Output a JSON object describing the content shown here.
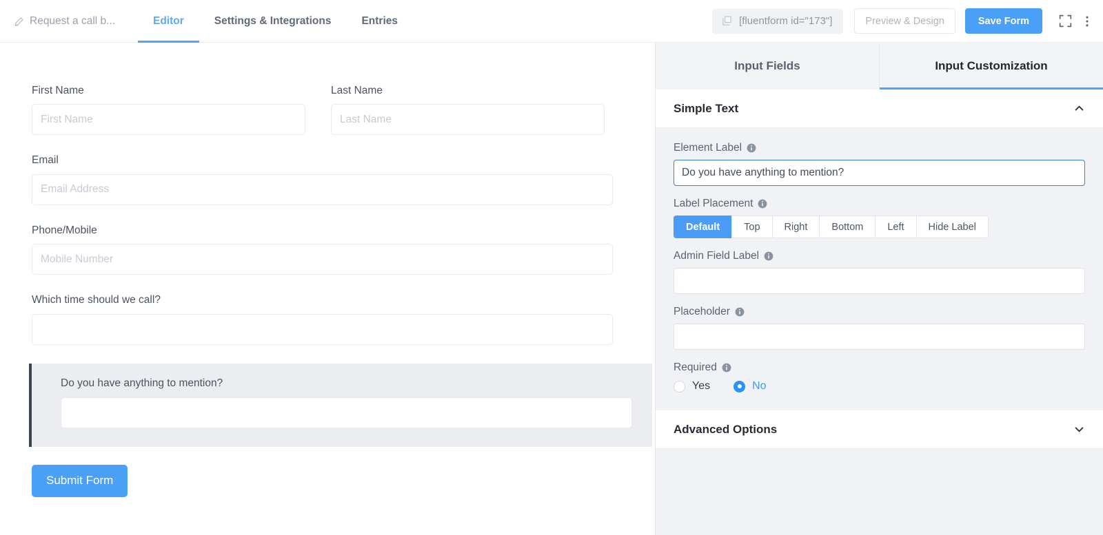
{
  "topbar": {
    "form_title": "Request a call b...",
    "edit_icon": "pencil-icon",
    "tabs": [
      {
        "label": "Editor",
        "active": true
      },
      {
        "label": "Settings & Integrations",
        "active": false
      },
      {
        "label": "Entries",
        "active": false
      }
    ],
    "shortcode": "[fluentform id=\"173\"]",
    "shortcode_icon": "copy-icon",
    "preview_label": "Preview & Design",
    "save_label": "Save Form",
    "fullscreen_icon": "expand-icon",
    "more_icon": "vertical-dots-icon",
    "accent_blue": "#4aa0f7"
  },
  "canvas": {
    "fields": [
      {
        "label": "First Name",
        "placeholder": "First Name",
        "value": "",
        "width": "half"
      },
      {
        "label": "Last Name",
        "placeholder": "Last Name",
        "value": "",
        "width": "half"
      },
      {
        "label": "Email",
        "placeholder": "Email Address",
        "value": "",
        "width": "full"
      },
      {
        "label": "Phone/Mobile",
        "placeholder": "Mobile Number",
        "value": "",
        "width": "full"
      },
      {
        "label": "Which time should we call?",
        "placeholder": "",
        "value": "",
        "width": "full"
      }
    ],
    "selected_field": {
      "label": "Do you have anything to mention?",
      "placeholder": "",
      "value": ""
    },
    "submit_label": "Submit Form"
  },
  "panel": {
    "tabs": [
      {
        "label": "Input Fields",
        "active": false
      },
      {
        "label": "Input Customization",
        "active": true
      }
    ],
    "simple_text": {
      "title": "Simple Text",
      "collapse_icon": "chevron-up-icon",
      "element_label": {
        "label": "Element Label",
        "info_icon": "info-icon",
        "value": "Do you have anything to mention?",
        "placeholder": ""
      },
      "label_placement": {
        "label": "Label Placement",
        "info_icon": "info-icon",
        "options": [
          "Default",
          "Top",
          "Right",
          "Bottom",
          "Left",
          "Hide Label"
        ],
        "selected": "Default"
      },
      "admin_field_label": {
        "label": "Admin Field Label",
        "info_icon": "info-icon",
        "value": "",
        "placeholder": ""
      },
      "placeholder_setting": {
        "label": "Placeholder",
        "info_icon": "info-icon",
        "value": "",
        "placeholder": ""
      },
      "required": {
        "label": "Required",
        "info_icon": "info-icon",
        "yes_label": "Yes",
        "no_label": "No",
        "selected": "No"
      }
    },
    "advanced_options": {
      "title": "Advanced Options",
      "expand_icon": "chevron-down-icon"
    }
  }
}
